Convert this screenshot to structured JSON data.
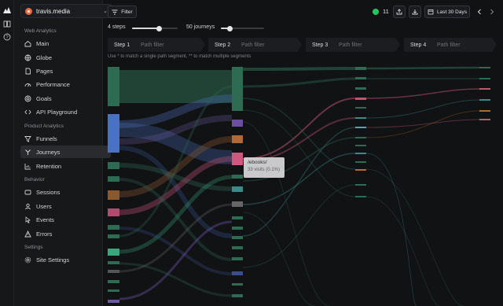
{
  "site": {
    "name": "travis.media"
  },
  "sections": [
    {
      "title": "Web Analytics",
      "items": [
        "Main",
        "Globe",
        "Pages",
        "Performance",
        "Goals",
        "API Playground"
      ]
    },
    {
      "title": "Product Analytics",
      "items": [
        "Funnels",
        "Journeys",
        "Retention"
      ]
    },
    {
      "title": "Behavior",
      "items": [
        "Sessions",
        "Users",
        "Events",
        "Errors"
      ]
    },
    {
      "title": "Settings",
      "items": [
        "Site Settings"
      ]
    }
  ],
  "active_item": "Journeys",
  "toolbar": {
    "filter_label": "Filter",
    "live_count": "11",
    "range_label": "Last 30 Days",
    "status_color": "#22c55e"
  },
  "controls": {
    "steps_label": "4 steps",
    "steps_level": 0.6,
    "journeys_label": "50 journeys",
    "journeys_level": 0.2
  },
  "steps": [
    {
      "label": "Step 1",
      "placeholder": "Path filter"
    },
    {
      "label": "Step 2",
      "placeholder": "Path filter"
    },
    {
      "label": "Step 3",
      "placeholder": "Path filter"
    },
    {
      "label": "Step 4",
      "placeholder": "Path filter"
    }
  ],
  "hint": "Use * to match a single path segment, ** to match multiple segments",
  "tooltip": {
    "path": "/ebooks/",
    "visits": "33 visits (0.1%)"
  }
}
